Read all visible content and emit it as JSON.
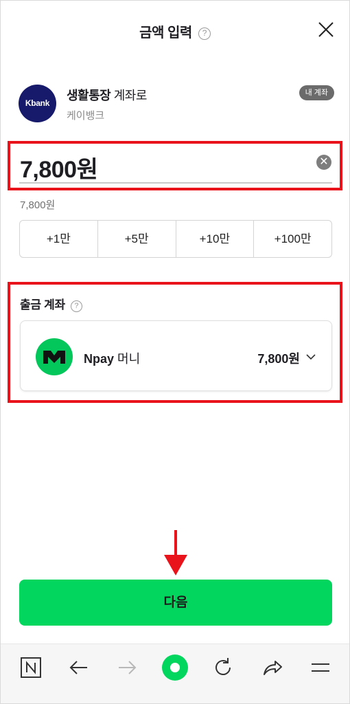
{
  "header": {
    "title": "금액 입력",
    "help_icon": "question-circle-icon",
    "help_glyph": "?",
    "close_icon": "close-icon"
  },
  "recipient": {
    "logo_text": "Kbank",
    "account_name": "생활통장",
    "account_suffix": " 계좌로",
    "bank_name": "케이뱅크",
    "badge": "내 계좌"
  },
  "amount": {
    "value": "7,800원",
    "sub_label": "7,800원",
    "clear_glyph": "✕",
    "quick_buttons": [
      "+1만",
      "+5만",
      "+10만",
      "+100만"
    ]
  },
  "withdraw": {
    "title": "출금 계좌",
    "help_glyph": "?",
    "account_brand": "Npay",
    "account_name": " 머니",
    "balance": "7,800원"
  },
  "next_button": {
    "label": "다음"
  },
  "bottom_nav": [
    "naver-n-icon",
    "back-arrow-icon",
    "forward-arrow-icon",
    "home-circle-icon",
    "refresh-icon",
    "share-icon",
    "menu-icon"
  ],
  "colors": {
    "accent_green": "#03d65e",
    "npay_green": "#03c75a",
    "highlight_red": "#e8131b",
    "kbank_navy": "#171a6b"
  }
}
